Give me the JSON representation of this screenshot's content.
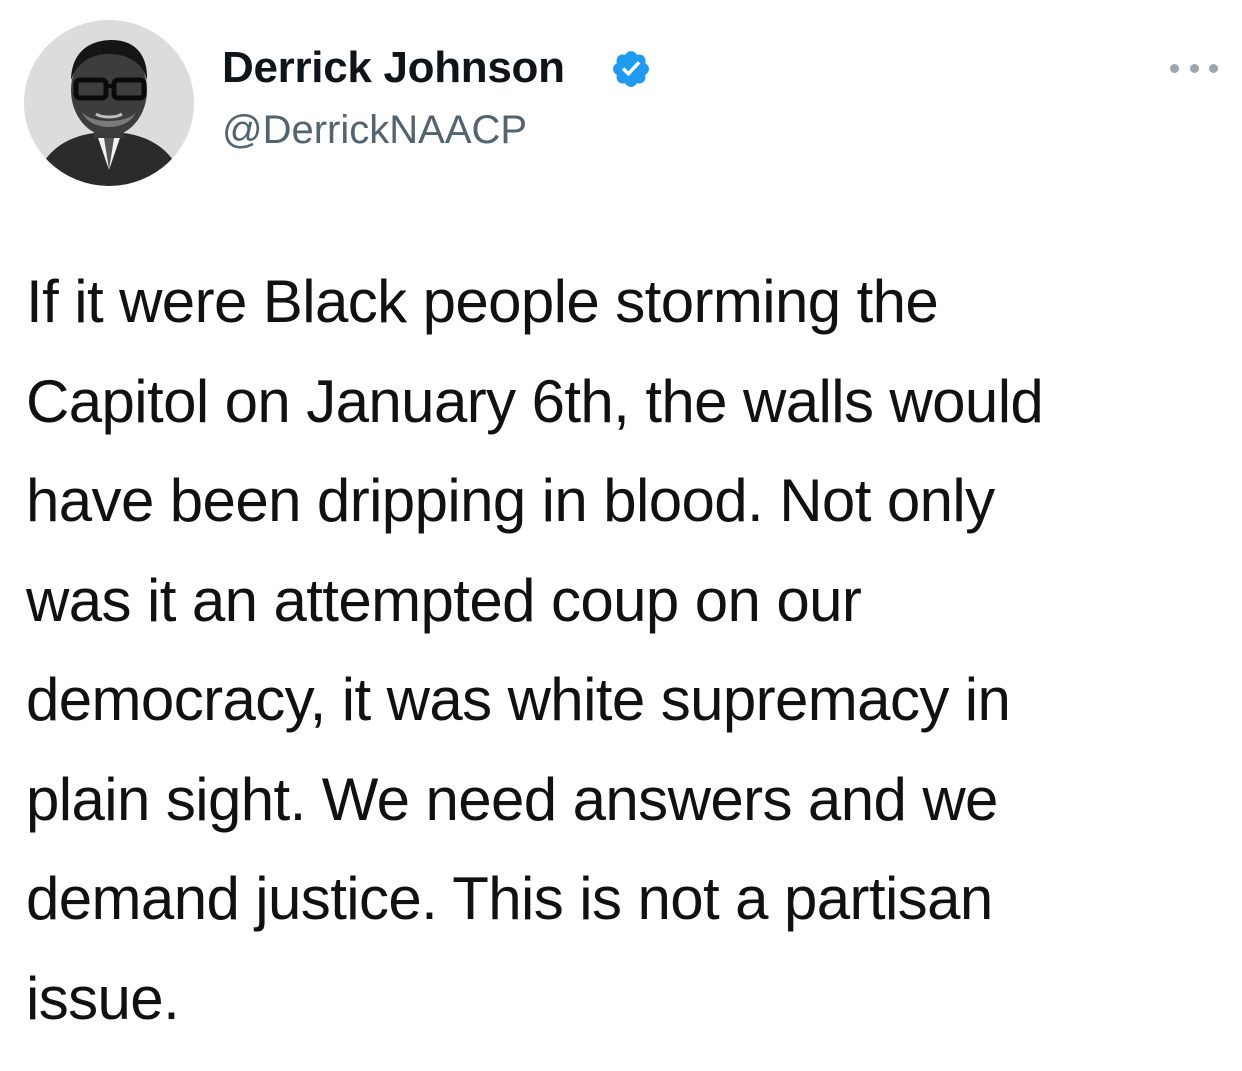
{
  "tweet": {
    "display_name": "Derrick Johnson",
    "handle": "@DerrickNAACP",
    "verified_icon": "verified-badge-icon",
    "more_icon": "more-options-icon",
    "text_lines": [
      "If it were Black people storming the",
      "Capitol on January 6th, the walls would",
      "have been dripping in blood. Not only",
      "was it an attempted coup on our",
      "democracy, it was white supremacy in",
      "plain sight. We need answers and we",
      "demand justice. This is not a partisan",
      "issue."
    ]
  },
  "colors": {
    "verified_blue": "#1d9bf0",
    "handle_gray": "#536471",
    "background": "#ffffff"
  }
}
